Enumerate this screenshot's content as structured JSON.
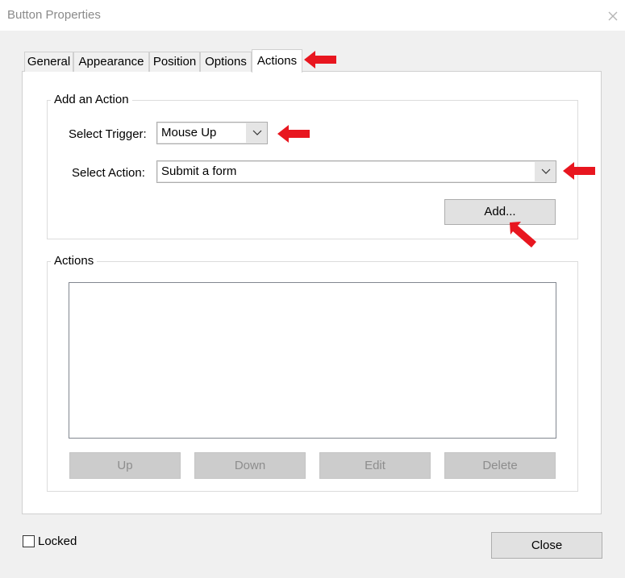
{
  "window": {
    "title": "Button Properties"
  },
  "tabs": [
    {
      "label": "General"
    },
    {
      "label": "Appearance"
    },
    {
      "label": "Position"
    },
    {
      "label": "Options"
    },
    {
      "label": "Actions"
    }
  ],
  "active_tab": "Actions",
  "add_action": {
    "legend": "Add an Action",
    "trigger_label": "Select Trigger:",
    "trigger_value": "Mouse Up",
    "action_label": "Select Action:",
    "action_value": "Submit a form",
    "add_button": "Add..."
  },
  "actions": {
    "legend": "Actions",
    "buttons": {
      "up": "Up",
      "down": "Down",
      "edit": "Edit",
      "delete": "Delete"
    }
  },
  "footer": {
    "locked_label": "Locked",
    "locked_checked": false,
    "close_button": "Close"
  },
  "annotation_color": "#e8161f"
}
